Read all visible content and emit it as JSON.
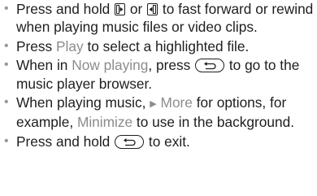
{
  "items": [
    {
      "parts": [
        "Press and hold",
        "or",
        "to fast forward or rewind when playing music files or video clips."
      ],
      "icons": [
        "forward-key-icon",
        "rewind-key-icon"
      ]
    },
    {
      "before": "Press",
      "hl": "Play",
      "after": "to select a highlighted file."
    },
    {
      "before": "When in",
      "hl": "Now playing",
      "mid": ", press",
      "after": "to go to the music player browser.",
      "icons": [
        "back-key-icon"
      ]
    },
    {
      "before": "When playing music,",
      "hl1": "More",
      "mid": "for options, for example,",
      "hl2": "Minimize",
      "after": "to use in the background."
    },
    {
      "before": "Press and hold",
      "after": "to exit.",
      "icons": [
        "back-key-icon"
      ]
    }
  ],
  "colors": {
    "text": "#1e1e1e",
    "highlight": "#8c8c8c",
    "bullet": "#999999"
  }
}
